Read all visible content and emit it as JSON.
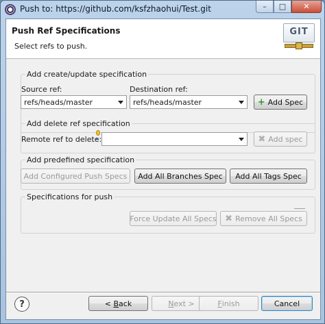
{
  "window": {
    "title": "Push to: https://github.com/ksfzhaohui/Test.git",
    "minimize_label": "–",
    "maximize_label": "□",
    "close_label": "✕"
  },
  "banner": {
    "title": "Push Ref Specifications",
    "description": "Select refs to push.",
    "logo_text": "GIT"
  },
  "create_update": {
    "group_title": "Add create/update specification",
    "source_label": "Source ref:",
    "source_value": "refs/heads/master",
    "destination_label": "Destination ref:",
    "destination_value": "refs/heads/master",
    "add_spec_label": "Add Spec"
  },
  "delete": {
    "group_title": "Add delete ref specification",
    "remote_label": "Remote ref to delete:",
    "remote_value": "",
    "add_spec_label": "Add spec"
  },
  "predefined": {
    "group_title": "Add predefined specification",
    "add_configured_label": "Add Configured Push Specs",
    "add_all_branches_label": "Add All Branches Spec",
    "add_all_tags_label": "Add All Tags Spec"
  },
  "specs": {
    "group_title": "Specifications for push",
    "force_update_label": "Force Update All Specs",
    "remove_all_label": "Remove All Specs"
  },
  "footer": {
    "help_label": "?",
    "back_mnemonic": "B",
    "back_rest": "ack",
    "back_prefix": "< ",
    "next_mnemonic": "N",
    "next_rest": "ext >",
    "finish_mnemonic": "F",
    "finish_rest": "inish",
    "cancel_label": "Cancel"
  },
  "colors": {
    "accent": "#3c7fb1",
    "add_icon": "#2a9a2a",
    "disabled_text": "#9a9a9a"
  }
}
